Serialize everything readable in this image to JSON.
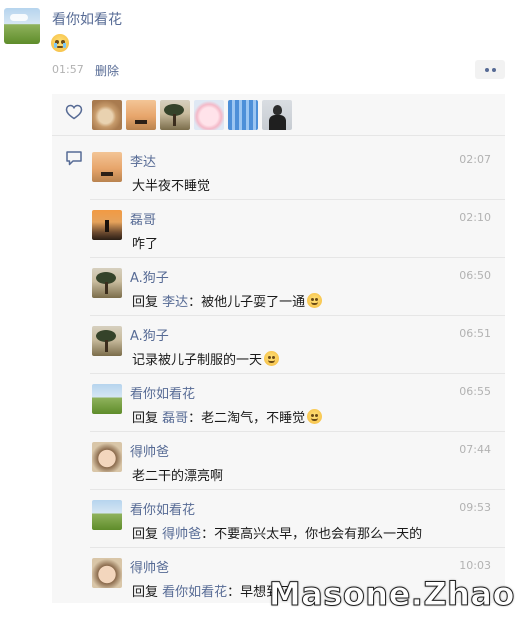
{
  "post": {
    "author": "看你如看花",
    "time": "01:57",
    "delete_label": "删除"
  },
  "likes": {
    "avatars": [
      "photo-avatar-1",
      "sunset-avatar",
      "photo-avatar-2",
      "cartoon-avatar",
      "blue-avatar",
      "person-avatar"
    ]
  },
  "comments": [
    {
      "name": "李达",
      "time": "02:07",
      "text": "大半夜不睡觉",
      "reply_to": "",
      "emoji": false
    },
    {
      "name": "磊哥",
      "time": "02:10",
      "text": "咋了",
      "reply_to": "",
      "emoji": false
    },
    {
      "name": "A.狗子",
      "time": "06:50",
      "reply_prefix": "回复",
      "reply_to": "李达",
      "text": "：被他儿子耍了一通",
      "emoji": true
    },
    {
      "name": "A.狗子",
      "time": "06:51",
      "text": "记录被儿子制服的一天",
      "reply_to": "",
      "emoji": true
    },
    {
      "name": "看你如看花",
      "time": "06:55",
      "reply_prefix": "回复",
      "reply_to": "磊哥",
      "text": "：老二淘气，不睡觉",
      "emoji": true
    },
    {
      "name": "得帅爸",
      "time": "07:44",
      "text": "老二干的漂亮啊",
      "reply_to": "",
      "emoji": false
    },
    {
      "name": "看你如看花",
      "time": "09:53",
      "reply_prefix": "回复",
      "reply_to": "得帅爸",
      "text": "：不要高兴太早，你也会有那么一天的",
      "emoji": false
    },
    {
      "name": "得帅爸",
      "time": "10:03",
      "reply_prefix": "回复",
      "reply_to": "看你如看花",
      "text": "：早想到了",
      "emoji": false
    }
  ],
  "watermark": "Masone.Zhao",
  "colors": {
    "link": "#576b95",
    "time": "#b2b2b2",
    "panel": "#f7f7f7"
  }
}
